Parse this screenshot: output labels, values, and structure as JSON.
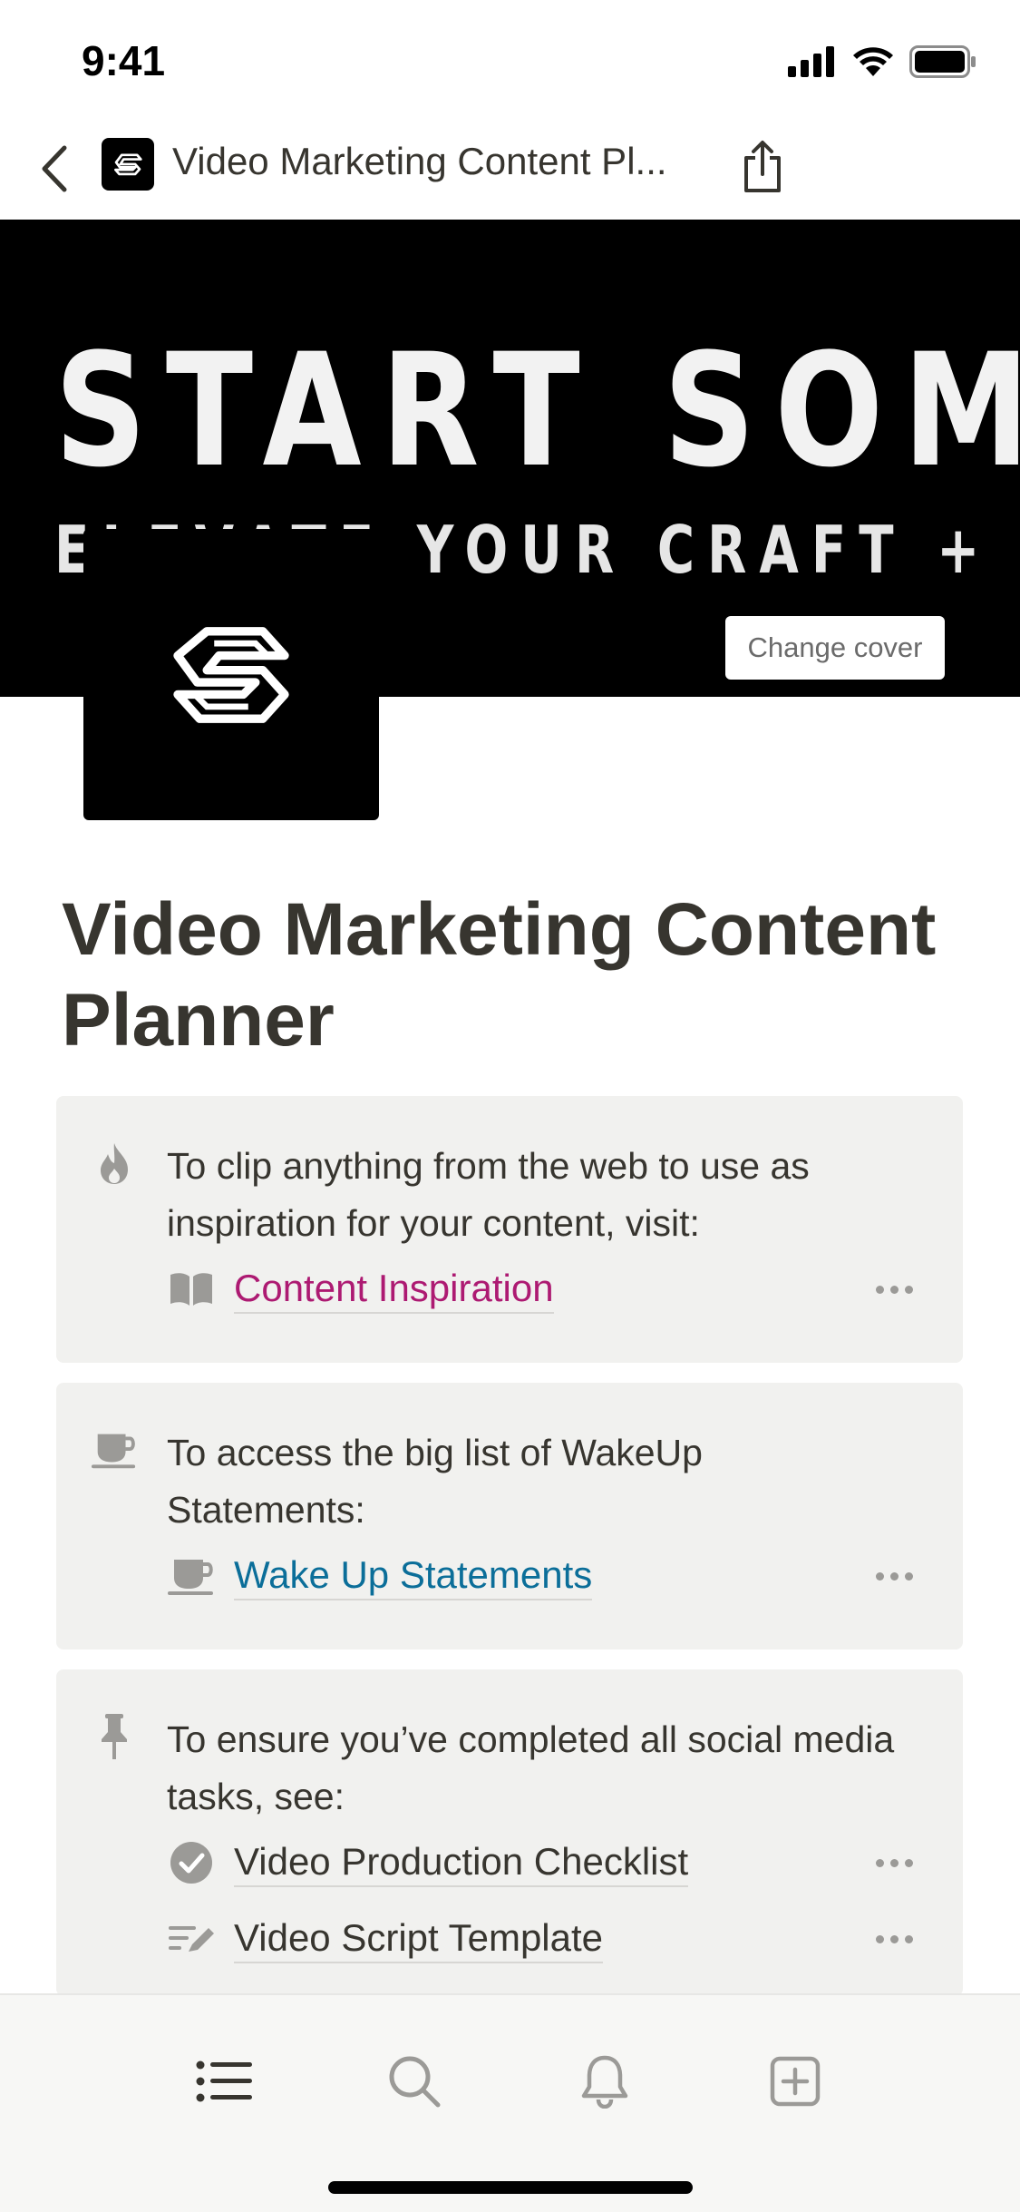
{
  "status_bar": {
    "time": "9:41"
  },
  "nav": {
    "title": "Video Marketing Content Pl..."
  },
  "cover": {
    "headline": "START SOME S",
    "subline": "ELEVATE YOUR CRAFT + WIN MO",
    "change_cover_label": "Change cover"
  },
  "page": {
    "title": "Video Marketing Content Planner"
  },
  "callouts": [
    {
      "icon": "flame-icon",
      "text": "To clip anything from the web to use as inspiration for your content, visit:",
      "links": [
        {
          "icon": "book-icon",
          "label": "Content Inspiration",
          "color": "#ad1a72"
        }
      ]
    },
    {
      "icon": "coffee-cup-icon",
      "text": "To access the big list of WakeUp Statements:",
      "links": [
        {
          "icon": "coffee-cup-icon",
          "label": "Wake Up Statements",
          "color": "#0b6e99"
        }
      ]
    },
    {
      "icon": "pin-icon",
      "text": "To ensure you’ve completed all social media tasks, see:",
      "links": [
        {
          "icon": "checkmark-circle-icon",
          "label": "Video Production Checklist",
          "color": "#37352f"
        },
        {
          "icon": "edit-text-icon",
          "label": "Video Script Template",
          "color": "#37352f"
        }
      ]
    }
  ],
  "bottom_tabs": [
    "list-icon",
    "search-icon",
    "bell-icon",
    "add-page-icon"
  ]
}
